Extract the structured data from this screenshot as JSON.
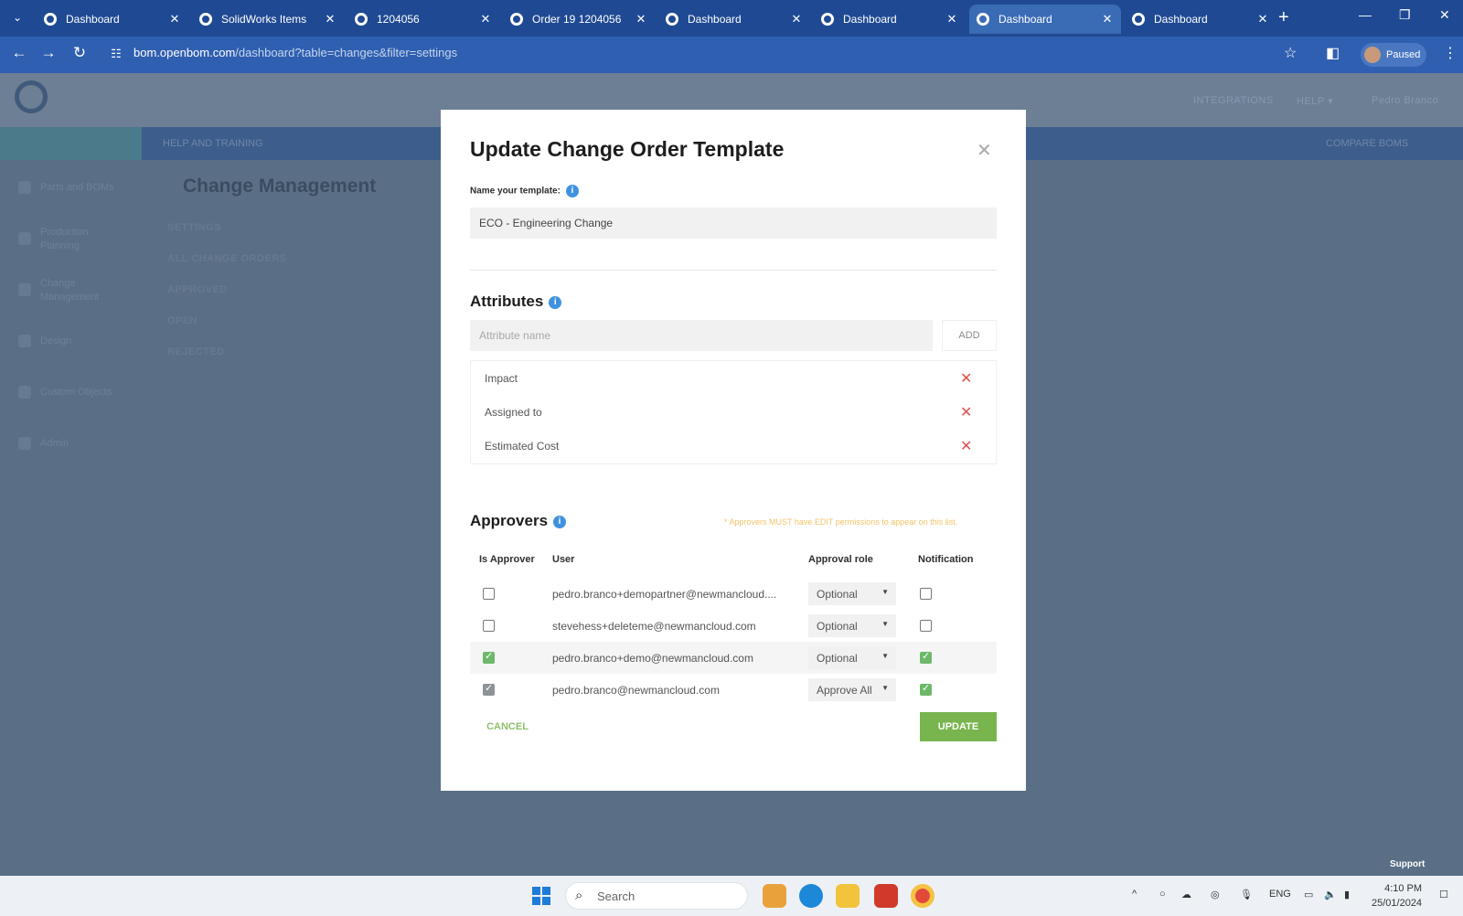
{
  "browser": {
    "tabs": [
      {
        "label": "Dashboard",
        "active": false
      },
      {
        "label": "SolidWorks Items",
        "active": false
      },
      {
        "label": "1204056",
        "active": false
      },
      {
        "label": "Order 19 1204056",
        "active": false
      },
      {
        "label": "Dashboard",
        "active": false
      },
      {
        "label": "Dashboard",
        "active": false
      },
      {
        "label": "Dashboard",
        "active": true
      },
      {
        "label": "Dashboard",
        "active": false
      }
    ],
    "url_host": "bom.openbom.com",
    "url_rest": "/dashboard?table=changes&filter=settings",
    "profile_label": "Paused"
  },
  "background": {
    "header_links": [
      "INTEGRATIONS",
      "HELP ▾",
      "Pedro Branco"
    ],
    "help_training": "HELP AND TRAINING",
    "compare_boms": "COMPARE BOMS",
    "sidebar": [
      "Parts and BOMs",
      "Production Planning",
      "Change Management",
      "Design",
      "Custom Objects",
      "Admin"
    ],
    "page_title": "Change Management",
    "nav_links": [
      "SETTINGS",
      "ALL CHANGE ORDERS",
      "APPROVED",
      "OPEN",
      "REJECTED"
    ],
    "support": "Support"
  },
  "modal": {
    "title": "Update Change Order Template",
    "name_label": "Name your template:",
    "name_value": "ECO - Engineering Change",
    "attributes_heading": "Attributes",
    "attribute_placeholder": "Attribute name",
    "add_label": "ADD",
    "attributes": [
      "Impact",
      "Assigned to",
      "Estimated Cost"
    ],
    "approvers_heading": "Approvers",
    "approvers_warning": "* Approvers MUST have EDIT permissions to appear on this list.",
    "columns": {
      "is_approver": "Is Approver",
      "user": "User",
      "role": "Approval role",
      "notification": "Notification"
    },
    "approvers": [
      {
        "user": "pedro.branco+demopartner@newmancloud....",
        "role": "Optional",
        "is_approver": false,
        "notification": false
      },
      {
        "user": "stevehess+deleteme@newmancloud.com",
        "role": "Optional",
        "is_approver": false,
        "notification": false
      },
      {
        "user": "pedro.branco+demo@newmancloud.com",
        "role": "Optional",
        "is_approver": true,
        "notification": true
      },
      {
        "user": "pedro.branco@newmancloud.com",
        "role": "Approve All",
        "is_approver": true,
        "notification": true
      }
    ],
    "cancel_label": "CANCEL",
    "update_label": "UPDATE"
  },
  "taskbar": {
    "search_placeholder": "Search",
    "lang": "ENG",
    "time": "4:10 PM",
    "date": "25/01/2024"
  },
  "colors": {
    "accent_green": "#78b54e",
    "delete_red": "#e05050",
    "info_blue": "#3f92e0",
    "chrome_blue": "#1f4a93"
  }
}
